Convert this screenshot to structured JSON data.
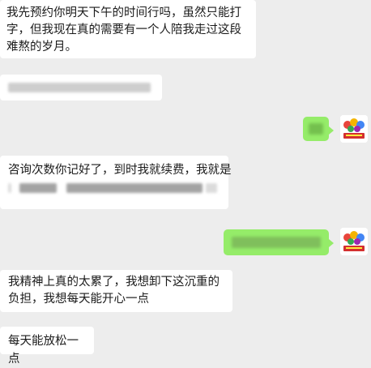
{
  "messages": {
    "m1": "我先预约你明天下午的时间行吗，虽然只能打字，但我现在真的需要有一个人陪我走过这段难熬的岁月。",
    "m2_line1": "咨询次数你记好了，到时我就续费，我就是",
    "m3": "我精神上真的太累了，我想卸下这沉重的负担，我想每天能开心一点",
    "m4": "每天能放松一点"
  },
  "colors": {
    "background": "#ededed",
    "incoming_bubble": "#ffffff",
    "outgoing_bubble": "#95ec69"
  },
  "icons": {
    "avatar": "colorful-logo-avatar"
  }
}
